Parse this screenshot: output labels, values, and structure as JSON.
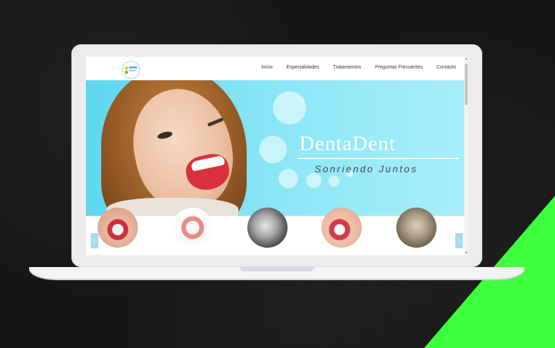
{
  "nav": {
    "items": [
      "Inicio",
      "Especialidades",
      "Tratamientos",
      "Preguntas Frecuentes",
      "Contacto"
    ]
  },
  "hero": {
    "brand": "DentaDent",
    "tagline": "Sonriendo Juntos"
  },
  "carousel": {
    "prev_icon": "chevron-left-icon",
    "next_icon": "chevron-right-icon",
    "prev_glyph": "‹",
    "next_glyph": "›",
    "items": [
      {
        "image": "smile-with-aligner",
        "label": ""
      },
      {
        "image": "dental-prosthesis",
        "label": ""
      },
      {
        "image": "dental-xray",
        "label": ""
      },
      {
        "image": "smile-with-tooth-tool",
        "label": ""
      },
      {
        "image": "tooth-closeup",
        "label": ""
      }
    ]
  },
  "colors": {
    "accent": "#3dff3d",
    "hero_bg": "#7fe0f3",
    "carousel_arrow": "#a6dcf2"
  }
}
